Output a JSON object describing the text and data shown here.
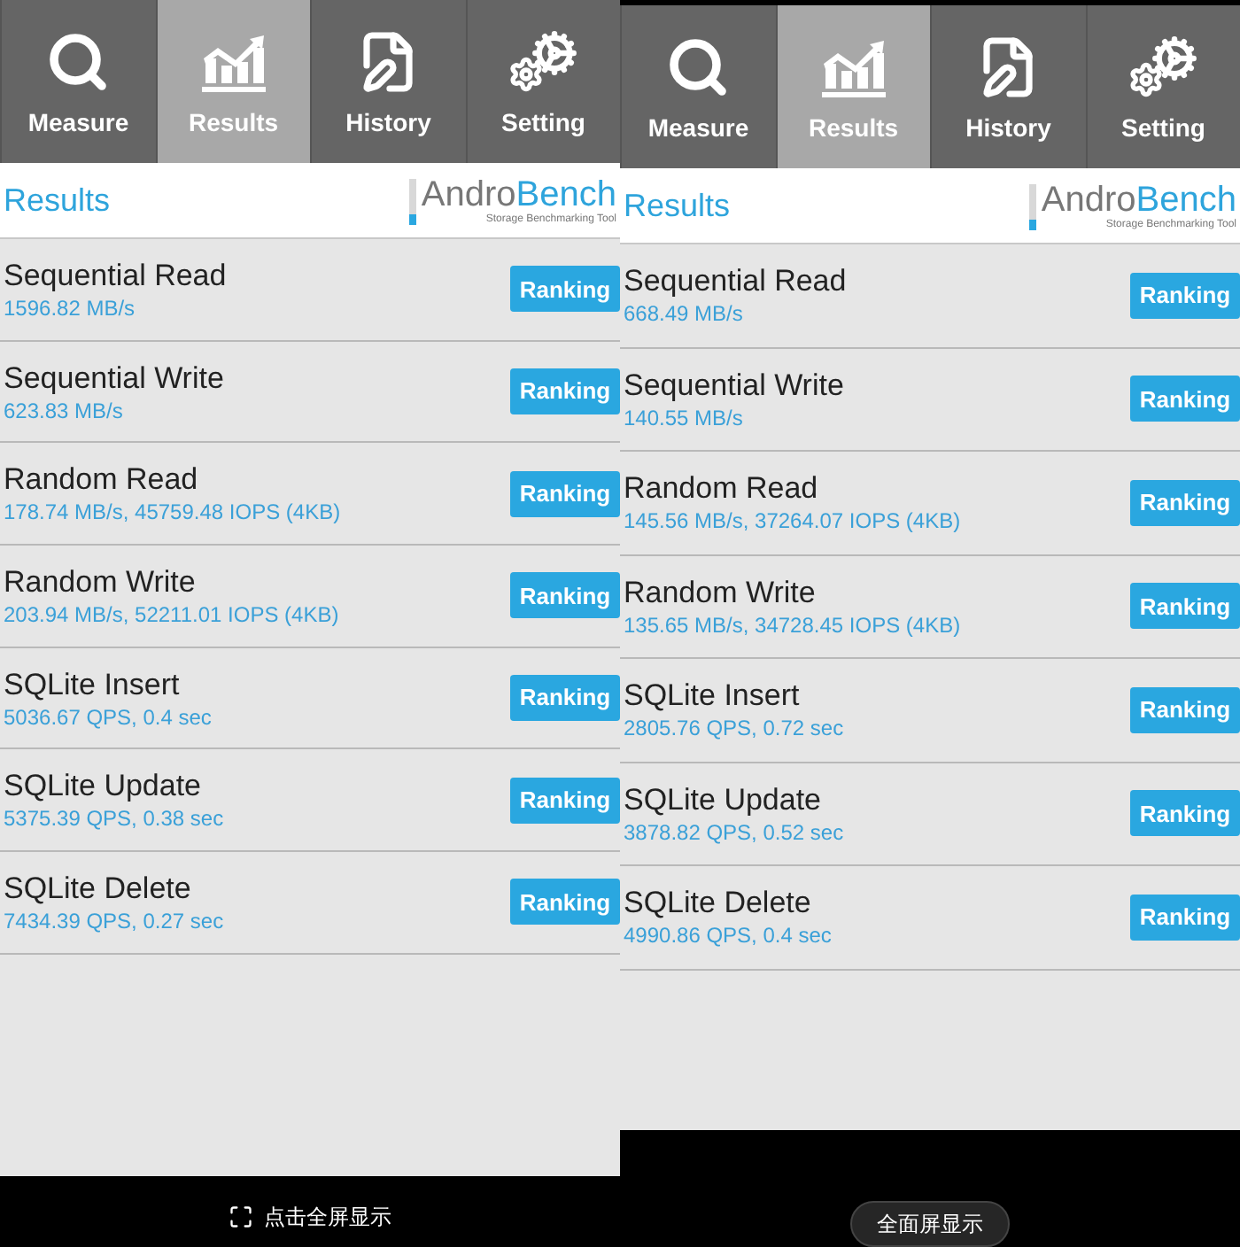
{
  "screens": [
    {
      "tabs": [
        {
          "label": "Measure",
          "selected": false
        },
        {
          "label": "Results",
          "selected": true
        },
        {
          "label": "History",
          "selected": false
        },
        {
          "label": "Setting",
          "selected": false
        }
      ],
      "header": {
        "title": "Results",
        "logo_dark": "Andro",
        "logo_blue": "Bench",
        "tagline": "Storage Benchmarking Tool"
      },
      "results": [
        {
          "name": "Sequential Read",
          "value": "1596.82 MB/s",
          "button": "Ranking"
        },
        {
          "name": "Sequential Write",
          "value": "623.83 MB/s",
          "button": "Ranking"
        },
        {
          "name": "Random Read",
          "value": "178.74 MB/s, 45759.48 IOPS (4KB)",
          "button": "Ranking"
        },
        {
          "name": "Random Write",
          "value": "203.94 MB/s, 52211.01 IOPS (4KB)",
          "button": "Ranking"
        },
        {
          "name": "SQLite Insert",
          "value": "5036.67 QPS, 0.4 sec",
          "button": "Ranking"
        },
        {
          "name": "SQLite Update",
          "value": "5375.39 QPS, 0.38 sec",
          "button": "Ranking"
        },
        {
          "name": "SQLite Delete",
          "value": "7434.39 QPS, 0.27 sec",
          "button": "Ranking"
        }
      ],
      "fullscreen": {
        "kind": "link",
        "label": "点击全屏显示"
      }
    },
    {
      "tabs": [
        {
          "label": "Measure",
          "selected": false
        },
        {
          "label": "Results",
          "selected": true
        },
        {
          "label": "History",
          "selected": false
        },
        {
          "label": "Setting",
          "selected": false
        }
      ],
      "header": {
        "title": "Results",
        "logo_dark": "Andro",
        "logo_blue": "Bench",
        "tagline": "Storage Benchmarking Tool"
      },
      "results": [
        {
          "name": "Sequential Read",
          "value": "668.49 MB/s",
          "button": "Ranking"
        },
        {
          "name": "Sequential Write",
          "value": "140.55 MB/s",
          "button": "Ranking"
        },
        {
          "name": "Random Read",
          "value": "145.56 MB/s, 37264.07 IOPS (4KB)",
          "button": "Ranking"
        },
        {
          "name": "Random Write",
          "value": "135.65 MB/s, 34728.45 IOPS (4KB)",
          "button": "Ranking"
        },
        {
          "name": "SQLite Insert",
          "value": "2805.76 QPS, 0.72 sec",
          "button": "Ranking"
        },
        {
          "name": "SQLite Update",
          "value": "3878.82 QPS, 0.52 sec",
          "button": "Ranking"
        },
        {
          "name": "SQLite Delete",
          "value": "4990.86 QPS, 0.4 sec",
          "button": "Ranking"
        }
      ],
      "fullscreen": {
        "kind": "pill",
        "label": "全面屏显示"
      }
    }
  ]
}
